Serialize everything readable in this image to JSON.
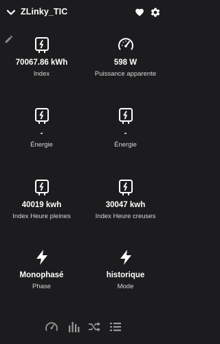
{
  "header": {
    "title": "ZLinky_TIC"
  },
  "tiles": [
    {
      "value": "70067.86 kWh",
      "label": "Index",
      "icon": "meter-icon"
    },
    {
      "value": "598 W",
      "label": "Puissance apparente",
      "icon": "gauge-icon"
    },
    {
      "value": "-",
      "label": "Énergie",
      "icon": "meter-icon"
    },
    {
      "value": "-",
      "label": "Énergie",
      "icon": "meter-icon"
    },
    {
      "value": "40019 kwh",
      "label": "Index Heure pleines",
      "icon": "meter-icon"
    },
    {
      "value": "30047 kwh",
      "label": "Index Heure creuses",
      "icon": "meter-icon"
    },
    {
      "value": "Monophasé",
      "label": "Phase",
      "icon": "lightning-icon"
    },
    {
      "value": "historique",
      "label": "Mode",
      "icon": "lightning-icon"
    }
  ],
  "bottom_nav": [
    {
      "icon": "speedometer-icon",
      "selected": true
    },
    {
      "icon": "bar-chart-icon",
      "selected": false
    },
    {
      "icon": "shuffle-icon",
      "selected": false
    },
    {
      "icon": "list-icon",
      "selected": false
    }
  ],
  "colors": {
    "background": "#1c1c1e",
    "text": "#ffffff",
    "secondary_text": "#d8d8d8",
    "nav_icon": "#9a9a9a"
  }
}
